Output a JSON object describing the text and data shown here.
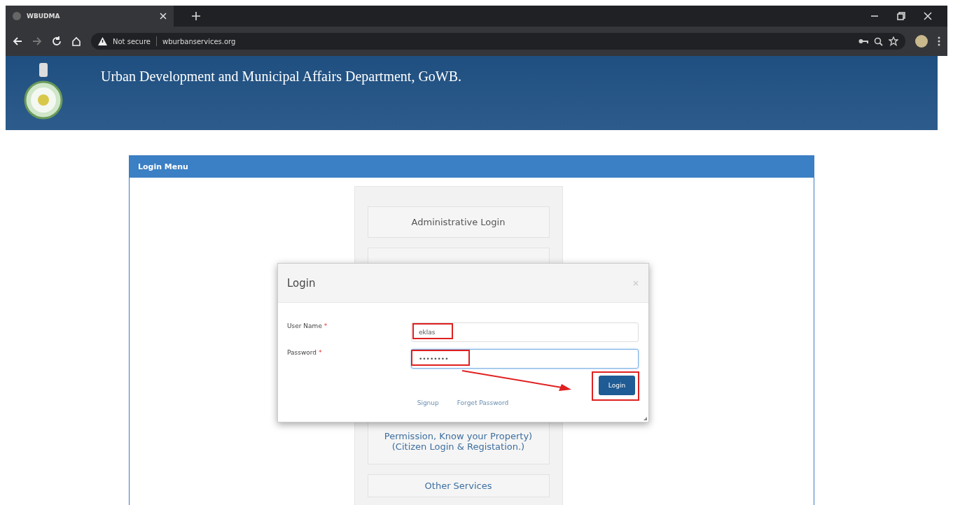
{
  "browser": {
    "tab_title": "WBUDMA",
    "security": "Not secure",
    "url": "wburbanservices.org"
  },
  "header": {
    "title": "Urban Development and Municipal Affairs Department, GoWB."
  },
  "panel": {
    "title": "Login Menu",
    "menu": [
      {
        "label": "Administrative Login"
      },
      {
        "label": "Permission, Know your Property)\n(Citizen Login & Registation.)"
      },
      {
        "label": "Other Services"
      }
    ]
  },
  "dialog": {
    "title": "Login",
    "fields": [
      {
        "label": "User Name",
        "marker": "*",
        "value": "eklas",
        "focused": false
      },
      {
        "label": "Password",
        "marker": "*",
        "value": "••••••••",
        "focused": true
      }
    ],
    "button": "Login",
    "links": [
      "Signup",
      "Forget Password"
    ]
  }
}
